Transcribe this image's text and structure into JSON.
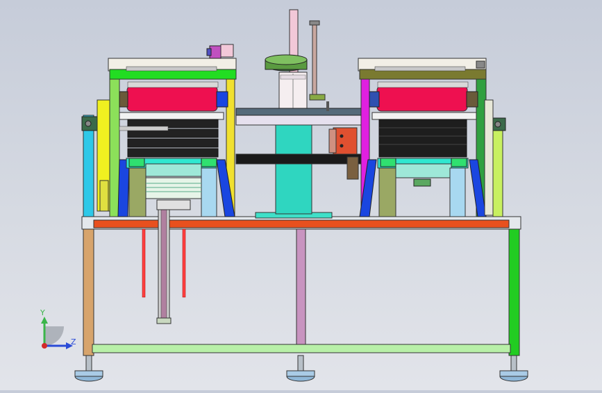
{
  "viewport": {
    "background_top": "#c6ccd9",
    "background_bottom": "#e2e4ea"
  },
  "triad": {
    "y_label": "Y",
    "z_label": "Z",
    "y_color": "#3bb54a",
    "z_color": "#2a4bd7",
    "x_color": "#d22a2a"
  },
  "colors": {
    "frame_green": "#22cc22",
    "frame_lightgreen": "#9fe39a",
    "table_orange": "#e8501e",
    "roller_red": "#ee1050",
    "cyan": "#2fd6c0",
    "yellow": "#f0f020",
    "magenta": "#e020e0",
    "blue": "#1a46e0",
    "dark": "#202020"
  }
}
